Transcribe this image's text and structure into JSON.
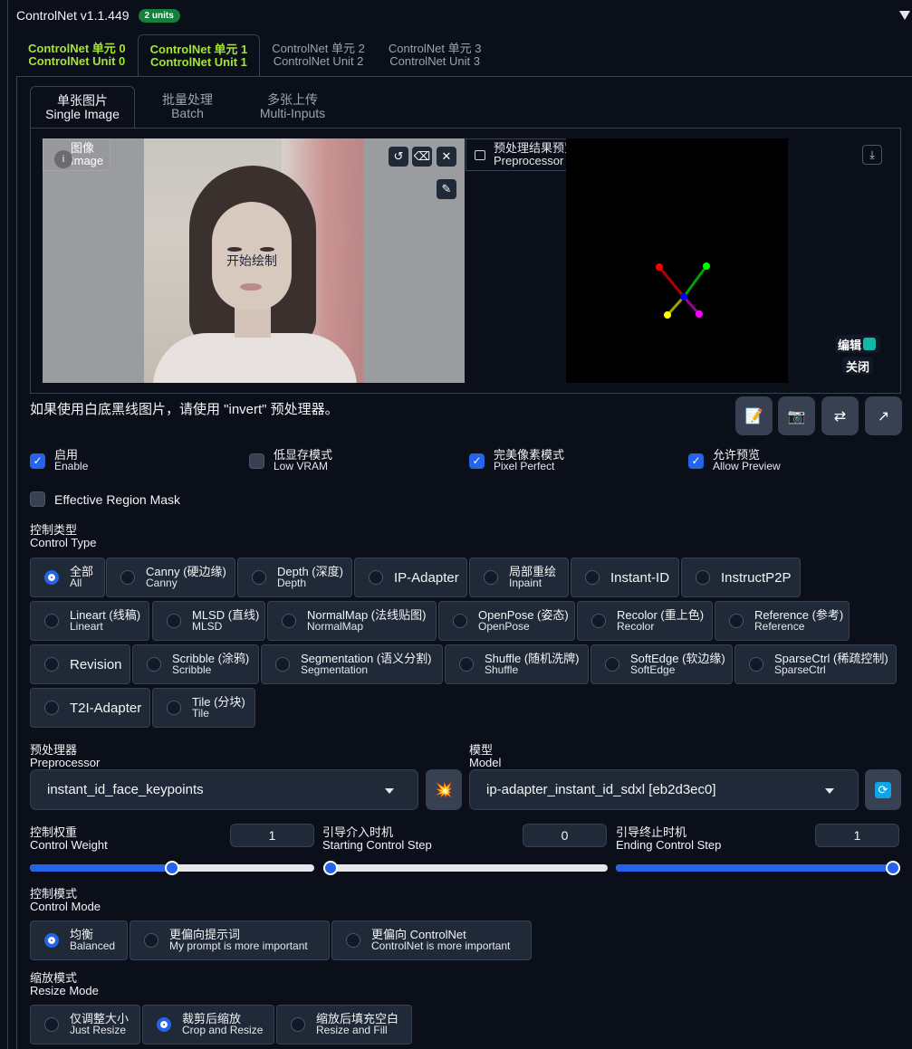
{
  "header": {
    "title": "ControlNet v1.1.449",
    "badge": "2 units"
  },
  "unit_tabs": [
    {
      "zh": "ControlNet 单元 0",
      "en": "ControlNet Unit 0"
    },
    {
      "zh": "ControlNet 单元 1",
      "en": "ControlNet Unit 1"
    },
    {
      "zh": "ControlNet 单元 2",
      "en": "ControlNet Unit 2"
    },
    {
      "zh": "ControlNet 单元 3",
      "en": "ControlNet Unit 3"
    }
  ],
  "image_tabs": [
    {
      "zh": "单张图片",
      "en": "Single Image"
    },
    {
      "zh": "批量处理",
      "en": "Batch"
    },
    {
      "zh": "多张上传",
      "en": "Multi-Inputs"
    }
  ],
  "image_panel": {
    "label_zh": "图像",
    "label_en": "Image",
    "overlay_text": "开始绘制"
  },
  "preview_panel": {
    "label_zh": "预处理结果预览",
    "label_en": "Preprocessor Preview",
    "edit_label": "编辑",
    "close_label": "关闭"
  },
  "hint": "如果使用白底黑线图片，请使用 \"invert\" 预处理器。",
  "checkboxes": [
    {
      "zh": "启用",
      "en": "Enable",
      "checked": true
    },
    {
      "zh": "低显存模式",
      "en": "Low VRAM",
      "checked": false
    },
    {
      "zh": "完美像素模式",
      "en": "Pixel Perfect",
      "checked": true
    },
    {
      "zh": "允许预览",
      "en": "Allow Preview",
      "checked": true
    }
  ],
  "effective_region_mask": {
    "label": "Effective Region Mask",
    "checked": false
  },
  "control_type": {
    "label_zh": "控制类型",
    "label_en": "Control Type",
    "options": [
      {
        "zh": "全部",
        "en": "All",
        "selected": true
      },
      {
        "zh": "Canny (硬边缘)",
        "en": "Canny"
      },
      {
        "zh": "Depth (深度)",
        "en": "Depth"
      },
      {
        "zh": "IP-Adapter",
        "en": ""
      },
      {
        "zh": "局部重绘",
        "en": "Inpaint"
      },
      {
        "zh": "Instant-ID",
        "en": ""
      },
      {
        "zh": "InstructP2P",
        "en": ""
      },
      {
        "zh": "Lineart (线稿)",
        "en": "Lineart"
      },
      {
        "zh": "MLSD (直线)",
        "en": "MLSD"
      },
      {
        "zh": "NormalMap (法线贴图)",
        "en": "NormalMap"
      },
      {
        "zh": "OpenPose (姿态)",
        "en": "OpenPose"
      },
      {
        "zh": "Recolor (重上色)",
        "en": "Recolor"
      },
      {
        "zh": "Reference (参考)",
        "en": "Reference"
      },
      {
        "zh": "Revision",
        "en": ""
      },
      {
        "zh": "Scribble (涂鸦)",
        "en": "Scribble"
      },
      {
        "zh": "Segmentation (语义分割)",
        "en": "Segmentation"
      },
      {
        "zh": "Shuffle (随机洗牌)",
        "en": "Shuffle"
      },
      {
        "zh": "SoftEdge (软边缘)",
        "en": "SoftEdge"
      },
      {
        "zh": "SparseCtrl (稀疏控制)",
        "en": "SparseCtrl"
      },
      {
        "zh": "T2I-Adapter",
        "en": ""
      },
      {
        "zh": "Tile (分块)",
        "en": "Tile"
      }
    ]
  },
  "preprocessor": {
    "label_zh": "预处理器",
    "label_en": "Preprocessor",
    "value": "instant_id_face_keypoints"
  },
  "model": {
    "label_zh": "模型",
    "label_en": "Model",
    "value": "ip-adapter_instant_id_sdxl [eb2d3ec0]"
  },
  "control_weight": {
    "label_zh": "控制权重",
    "label_en": "Control Weight",
    "value": "1",
    "fraction": 0.5
  },
  "starting_step": {
    "label_zh": "引导介入时机",
    "label_en": "Starting Control Step",
    "value": "0",
    "fraction": 0
  },
  "ending_step": {
    "label_zh": "引导终止时机",
    "label_en": "Ending Control Step",
    "value": "1",
    "fraction": 1
  },
  "control_mode": {
    "label_zh": "控制模式",
    "label_en": "Control Mode",
    "options": [
      {
        "zh": "均衡",
        "en": "Balanced",
        "selected": true
      },
      {
        "zh": "更偏向提示词",
        "en": "My prompt is more important"
      },
      {
        "zh": "更偏向 ControlNet",
        "en": "ControlNet is more important"
      }
    ]
  },
  "resize_mode": {
    "label_zh": "缩放模式",
    "label_en": "Resize Mode",
    "options": [
      {
        "zh": "仅调整大小",
        "en": "Just Resize"
      },
      {
        "zh": "裁剪后缩放",
        "en": "Crop and Resize",
        "selected": true
      },
      {
        "zh": "缩放后填充空白",
        "en": "Resize and Fill"
      }
    ]
  },
  "keypoint_colors": [
    "#ff0000",
    "#00ff00",
    "#0000ff",
    "#ffff00",
    "#ff00ff"
  ]
}
